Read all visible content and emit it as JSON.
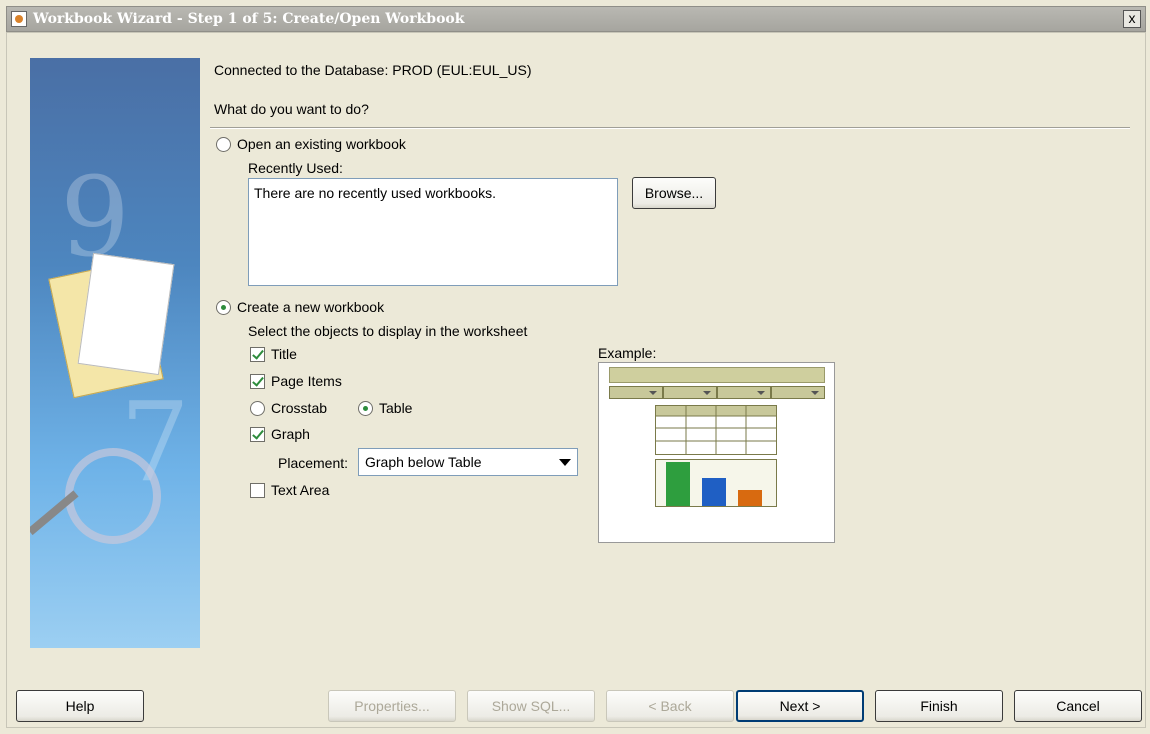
{
  "window": {
    "title": "Workbook Wizard - Step 1 of 5: Create/Open Workbook",
    "close_label": "x"
  },
  "connection_text": "Connected to the Database: PROD (EUL:EUL_US)",
  "question": "What do you want to do?",
  "open_existing": {
    "label": "Open an existing workbook",
    "selected": false,
    "recently_used_label": "Recently Used:",
    "recent_list_text": "There are no recently used workbooks.",
    "browse_label": "Browse..."
  },
  "create_new": {
    "label": "Create a new workbook",
    "selected": true,
    "objects_prompt": "Select the objects to display in the worksheet",
    "options": {
      "title": {
        "label": "Title",
        "checked": true
      },
      "page_items": {
        "label": "Page Items",
        "checked": true
      },
      "crosstab": {
        "label": "Crosstab",
        "selected": false
      },
      "table": {
        "label": "Table",
        "selected": true
      },
      "graph": {
        "label": "Graph",
        "checked": true
      },
      "text_area": {
        "label": "Text Area",
        "checked": false
      }
    },
    "placement": {
      "label": "Placement:",
      "value": "Graph below Table"
    },
    "example_label": "Example:"
  },
  "example_colors": {
    "bar1": "#2e9e3e",
    "bar2": "#1f5fc4",
    "bar3": "#d86a10",
    "header": "#cfcf9e"
  },
  "buttons": {
    "help": "Help",
    "properties": "Properties...",
    "show_sql": "Show SQL...",
    "back": "< Back",
    "next": "Next >",
    "finish": "Finish",
    "cancel": "Cancel"
  }
}
